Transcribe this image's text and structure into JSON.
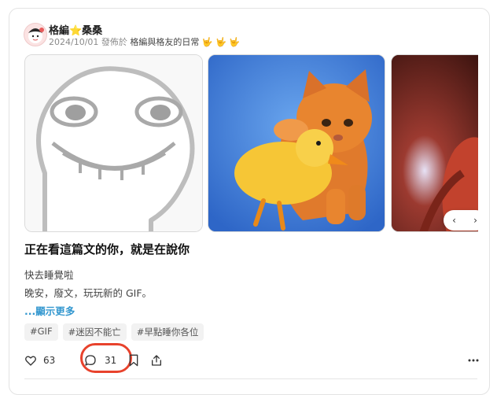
{
  "post": {
    "author": "格編⭐桑桑",
    "date": "2024/10/01",
    "posted_in": "發佈於",
    "board": "格編與格友的日常 🤟 🤟 🤟",
    "title": "正在看這篇文的你，就是在說你",
    "body_lines": [
      "快去睡覺啦",
      "晚安，廢文，玩玩新的 GIF。"
    ],
    "show_more": "...顯示更多",
    "tags": [
      "#GIF",
      "#迷因不能亡",
      "#早點睡你各位"
    ]
  },
  "gallery": {
    "prev": "‹",
    "next": "›",
    "items": [
      "smiling-face-drawing",
      "kitten-and-duckling-photo",
      "partial-dark-red-photo"
    ]
  },
  "actions": {
    "likes": "63",
    "comments": "31"
  },
  "colors": {
    "accent_link": "#3397cf",
    "highlight_ring": "#e8422c"
  }
}
